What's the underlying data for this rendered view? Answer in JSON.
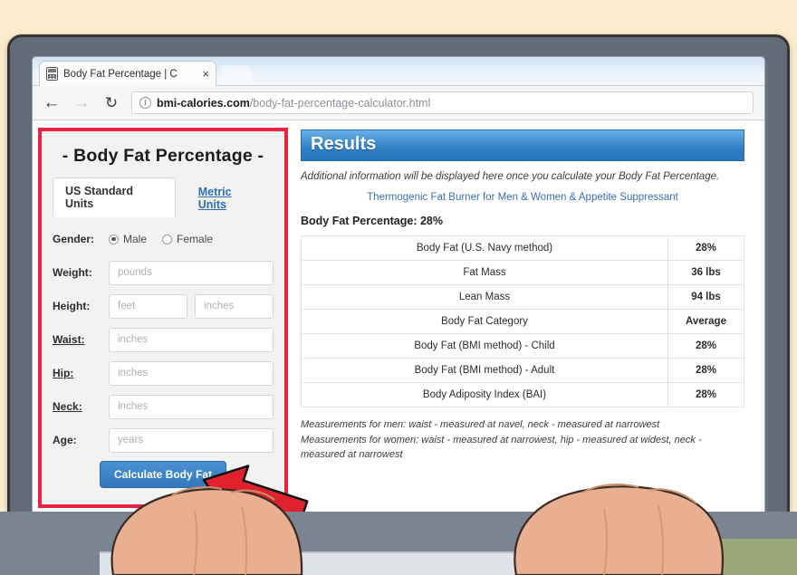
{
  "browser": {
    "tab": {
      "title": "Body Fat Percentage | C",
      "close_label": "×",
      "favicon": "calculator-icon"
    },
    "nav": {
      "back": "←",
      "forward": "→",
      "reload": "↻",
      "info": "i"
    },
    "url": {
      "host": "bmi-calories.com",
      "path": "/body-fat-percentage-calculator.html"
    }
  },
  "form": {
    "title": "- Body Fat Percentage -",
    "tabs": [
      {
        "label": "US Standard Units",
        "active": true
      },
      {
        "label": "Metric Units",
        "active": false
      }
    ],
    "gender": {
      "label": "Gender:",
      "options": [
        {
          "label": "Male",
          "selected": true
        },
        {
          "label": "Female",
          "selected": false
        }
      ]
    },
    "fields": [
      {
        "label": "Weight:",
        "placeholder": "pounds",
        "value": ""
      },
      {
        "label": "Height:",
        "placeholder": "feet",
        "placeholder2": "inches",
        "value": ""
      },
      {
        "label": "Waist:",
        "placeholder": "inches",
        "value": ""
      },
      {
        "label": "Hip:",
        "placeholder": "inches",
        "value": ""
      },
      {
        "label": "Neck:",
        "placeholder": "inches",
        "value": ""
      },
      {
        "label": "Age:",
        "placeholder": "years",
        "value": ""
      }
    ],
    "submit_label": "Calculate Body Fat",
    "highlight_color": "#e8233f"
  },
  "results": {
    "header": "Results",
    "note": "Additional information will be displayed here once you calculate your Body Fat Percentage.",
    "promo": "Thermogenic Fat Burner for Men & Women & Appetite Suppressant",
    "summary": "Body Fat Percentage: 28%",
    "rows": [
      {
        "label": "Body Fat (U.S. Navy method)",
        "value": "28%"
      },
      {
        "label": "Fat Mass",
        "value": "36 lbs"
      },
      {
        "label": "Lean Mass",
        "value": "94 lbs"
      },
      {
        "label": "Body Fat Category",
        "value": "Average"
      },
      {
        "label": "Body Fat (BMI method) - Child",
        "value": "28%"
      },
      {
        "label": "Body Fat (BMI method) - Adult",
        "value": "28%"
      },
      {
        "label": "Body Adiposity Index (BAI)",
        "value": "28%"
      }
    ],
    "footnote1": "Measurements for men: waist - measured at navel, neck - measured at narrowest",
    "footnote2": "Measurements for women: waist - measured at narrowest, hip - measured at widest, neck - measured at narrowest",
    "header_color": "#2f7fc4"
  },
  "annotation": {
    "arrow": "red-arrow-pointing-at-calculate-button",
    "color": "#e0222e"
  },
  "scene": {
    "background_color": "#fbeccd",
    "laptop_color": "#626c79",
    "desk_color": "#7b8491"
  }
}
